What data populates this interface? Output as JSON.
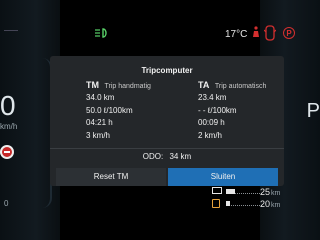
{
  "status": {
    "temperature": "17°C",
    "park_label": "P",
    "left_speed": "0",
    "left_speed_unit": "km/h",
    "left_zero": "0",
    "right_gear": "P"
  },
  "dialog": {
    "title": "Tripcomputer",
    "tm": {
      "code": "TM",
      "subtitle": "Trip handmatig",
      "distance": "34.0 km",
      "consumption": "50.0 ℓ/100km",
      "time": "04:21 h",
      "speed": "3 km/h"
    },
    "ta": {
      "code": "TA",
      "subtitle": "Trip automatisch",
      "distance": "23.4 km",
      "consumption": "- - ℓ/100km",
      "time": "00:09 h",
      "speed": "2 km/h"
    },
    "odo_label": "ODO:",
    "odo_value": "34 km",
    "reset_label": "Reset TM",
    "close_label": "Sluiten"
  },
  "range": {
    "electric": "25",
    "electric_unit": "km",
    "electric_level": 0.25,
    "fuel": "20",
    "fuel_unit": "km",
    "fuel_level": 0.1
  },
  "colors": {
    "accent": "#1f6fb5",
    "warning_red": "#d32f2f",
    "lights_green": "#58d068"
  },
  "icons": [
    "lights-icon",
    "seatbelt-icon",
    "car-doors-icon",
    "parking-brake-icon",
    "no-entry-icon",
    "battery-icon",
    "fuel-icon"
  ]
}
